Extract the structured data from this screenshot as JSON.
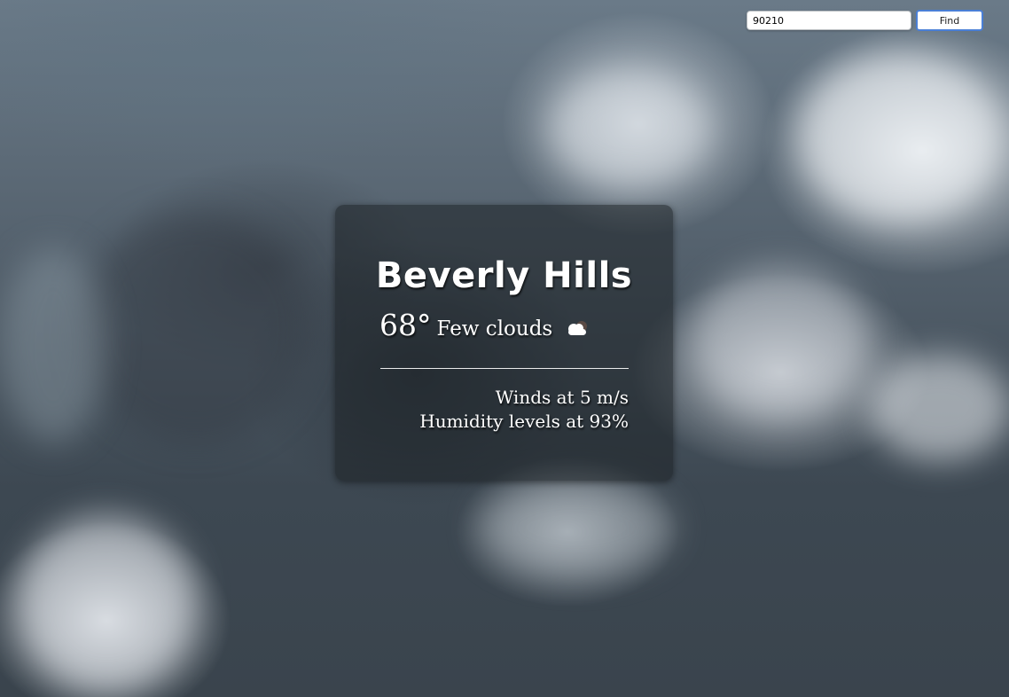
{
  "search": {
    "value": "90210",
    "button_label": "Find"
  },
  "weather": {
    "city": "Beverly Hills",
    "temperature": "68°",
    "condition": "Few clouds",
    "icon": "few-clouds-icon",
    "wind": "Winds at 5 m/s",
    "humidity": "Humidity levels at 93%"
  }
}
